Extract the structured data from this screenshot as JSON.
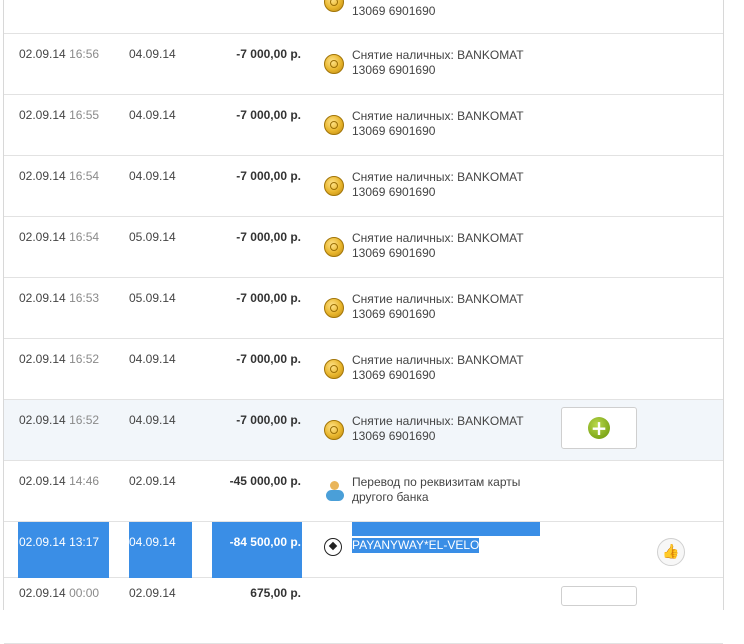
{
  "rows": [
    {
      "op_date": "",
      "op_time": "",
      "post_date": "",
      "amount": "",
      "icon": "coin-icon",
      "desc": "13069 6901690",
      "desc_partial": true
    },
    {
      "op_date": "02.09.14",
      "op_time": "16:56",
      "post_date": "04.09.14",
      "amount": "-7 000,00 р.",
      "icon": "coin-icon",
      "desc": "Снятие наличных: BANKOMAT 13069 6901690"
    },
    {
      "op_date": "02.09.14",
      "op_time": "16:55",
      "post_date": "04.09.14",
      "amount": "-7 000,00 р.",
      "icon": "coin-icon",
      "desc": "Снятие наличных: BANKOMAT 13069 6901690"
    },
    {
      "op_date": "02.09.14",
      "op_time": "16:54",
      "post_date": "04.09.14",
      "amount": "-7 000,00 р.",
      "icon": "coin-icon",
      "desc": "Снятие наличных: BANKOMAT 13069 6901690"
    },
    {
      "op_date": "02.09.14",
      "op_time": "16:54",
      "post_date": "05.09.14",
      "amount": "-7 000,00 р.",
      "icon": "coin-icon",
      "desc": "Снятие наличных: BANKOMAT 13069 6901690"
    },
    {
      "op_date": "02.09.14",
      "op_time": "16:53",
      "post_date": "05.09.14",
      "amount": "-7 000,00 р.",
      "icon": "coin-icon",
      "desc": "Снятие наличных: BANKOMAT 13069 6901690"
    },
    {
      "op_date": "02.09.14",
      "op_time": "16:52",
      "post_date": "04.09.14",
      "amount": "-7 000,00 р.",
      "icon": "coin-icon",
      "desc": "Снятие наличных: BANKOMAT 13069 6901690"
    },
    {
      "op_date": "02.09.14",
      "op_time": "16:52",
      "post_date": "04.09.14",
      "amount": "-7 000,00 р.",
      "icon": "coin-icon",
      "desc": "Снятие наличных: BANKOMAT 13069 6901690",
      "highlight": true,
      "action": "add"
    },
    {
      "op_date": "02.09.14",
      "op_time": "14:46",
      "post_date": "02.09.14",
      "amount": "-45 000,00 р.",
      "icon": "piggy-bank-icon",
      "desc": "Перевод по реквизитам карты другого банка"
    },
    {
      "op_date": "02.09.14",
      "op_time": "13:17",
      "post_date": "04.09.14",
      "amount": "-84 500,00 р.",
      "icon": "soccer-ball-icon",
      "desc": "PAYANYWAY*EL-VELO",
      "selected": true,
      "action": "like"
    },
    {
      "op_date": "02.09.14",
      "op_time": "00:00",
      "post_date": "02.09.14",
      "amount": "675,00 р.",
      "icon": "",
      "desc": "",
      "partial": true
    }
  ],
  "actions": {
    "add_symbol": "+",
    "like_symbol": "👍"
  }
}
